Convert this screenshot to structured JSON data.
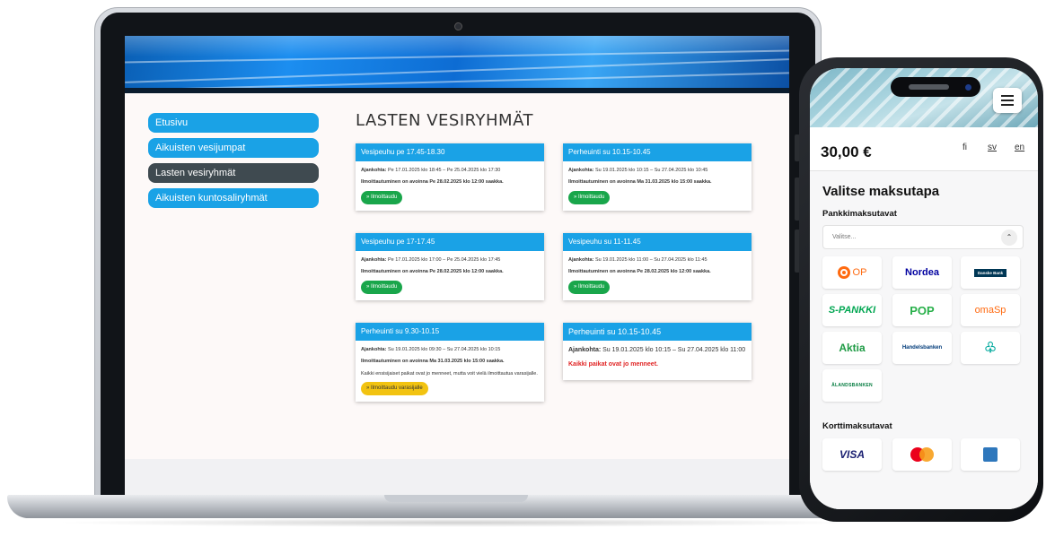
{
  "website": {
    "nav": [
      {
        "label": "Etusivu",
        "active": false
      },
      {
        "label": "Aikuisten vesijumpat",
        "active": false
      },
      {
        "label": "Lasten vesiryhmät",
        "active": true
      },
      {
        "label": "Aikuisten kuntosaliryhmät",
        "active": false
      }
    ],
    "page_title": "LASTEN VESIRYHMÄT",
    "cards": [
      {
        "title": "Vesipeuhu pe 17.45-18.30",
        "time_label": "Ajankohta:",
        "time_value": "Pe 17.01.2025 klo 18:45 – Pe 25.04.2025 klo 17:30",
        "signup": "Ilmoittautuminen on avoinna Pe 28.02.2025 klo 12:00 saakka.",
        "button": "» Ilmoittaudu"
      },
      {
        "title": "Perheuinti su 10.15-10.45",
        "time_label": "Ajankohta:",
        "time_value": "Su 19.01.2025 klo 10:15 – Su 27.04.2025 klo 10:45",
        "signup": "Ilmoittautuminen on avoinna Ma 31.03.2025 klo 15:00 saakka.",
        "button": "» Ilmoittaudu"
      },
      {
        "title": "Vesipeuhu pe 17-17.45",
        "time_label": "Ajankohta:",
        "time_value": "Pe 17.01.2025 klo 17:00 – Pe 25.04.2025 klo 17:45",
        "signup": "Ilmoittautuminen on avoinna Pe 28.02.2025 klo 12:00 saakka.",
        "button": "» Ilmoittaudu"
      },
      {
        "title": "Vesipeuhu su 11-11.45",
        "time_label": "Ajankohta:",
        "time_value": "Su 19.01.2025 klo 11:00 – Su 27.04.2025 klo 11:45",
        "signup": "Ilmoittautuminen on avoinna Pe 28.02.2025 klo 12:00 saakka.",
        "button": "» Ilmoittaudu"
      },
      {
        "title": "Perheuinti su 9.30-10.15",
        "time_label": "Ajankohta:",
        "time_value": "Su 19.01.2025 klo 09:30 – Su 27.04.2025 klo 10:15",
        "signup": "Ilmoittautuminen on avoinna Ma 31.03.2025 klo 15:00 saakka.",
        "note": "Kaikki ensisijaiset paikat ovat jo menneet, mutta voit vielä ilmoittautua varasijalle.",
        "button": "» Ilmoittaudu varasijalle"
      },
      {
        "title": "Perheuinti su 10.15-10.45",
        "time_label": "Ajankohta:",
        "time_value": "Su 19.01.2025 klo 10:15 – Su 27.04.2025 klo 11:00",
        "full_text": "Kaikki paikat ovat jo menneet."
      }
    ]
  },
  "payment": {
    "amount": "30,00 €",
    "languages": [
      "fi",
      "sv",
      "en"
    ],
    "heading": "Valitse maksutapa",
    "bank_heading": "Pankkimaksutavat",
    "select_placeholder": "Valitse...",
    "banks": [
      "OP",
      "Nordea",
      "Danske Bank",
      "S-PANKKI",
      "POP",
      "omaSp",
      "Aktia",
      "Handelsbanken",
      "Säästöpankki",
      "ÅLANDSBANKEN"
    ],
    "card_heading": "Korttimaksutavat",
    "cards": [
      "VISA",
      "Mastercard",
      "American Express"
    ],
    "colors": {
      "accent": "#1aa2e6",
      "active_nav": "#3f4a50",
      "green_button": "#19a64b",
      "yellow_button": "#f2c311",
      "error_red": "#e02424"
    }
  }
}
